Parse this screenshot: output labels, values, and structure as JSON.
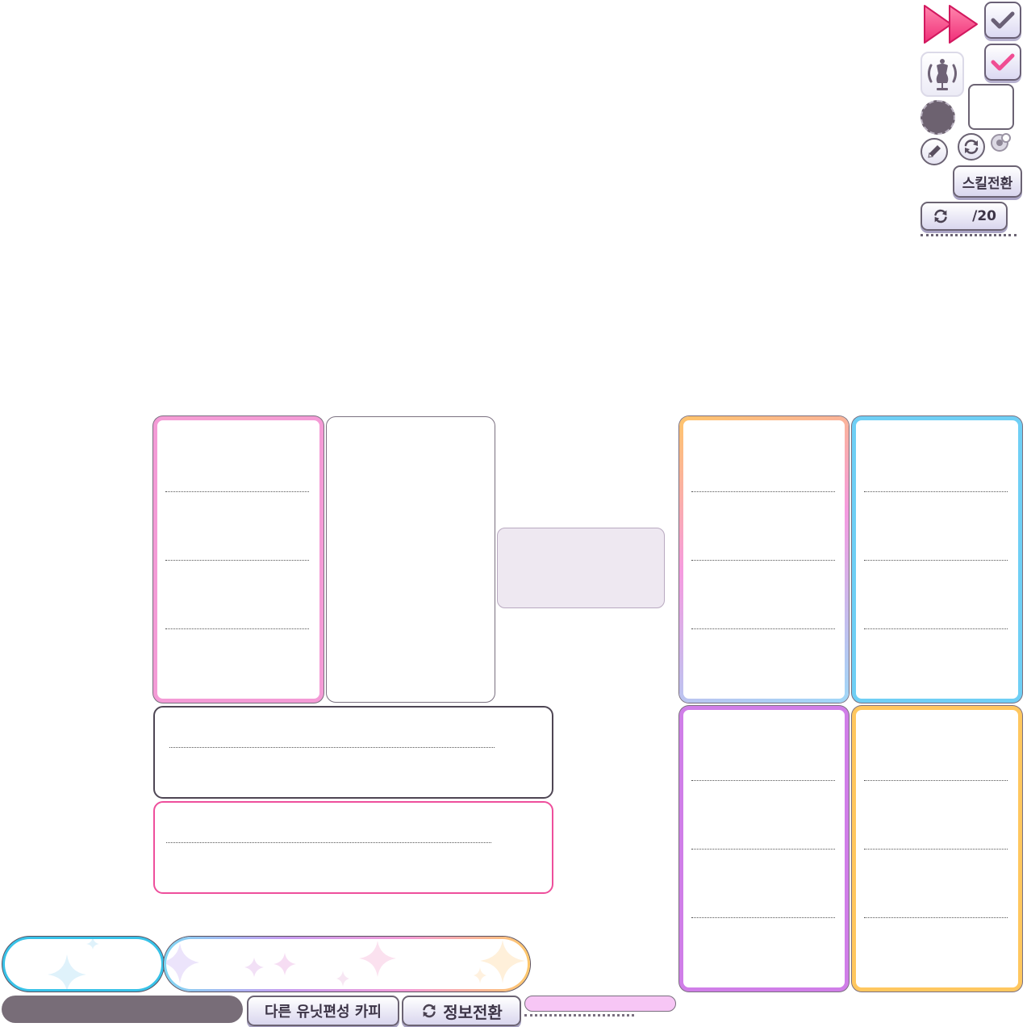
{
  "top_controls": {
    "skill_switch_label": "스킬전환",
    "refresh_count": "/20",
    "colors": {
      "fast_forward": "#ff4f8b",
      "check_gray": "#6a6076",
      "check_pink": "#f04d93"
    }
  },
  "bottom": {
    "copy_button_label": "다른 유닛편성 카피",
    "info_switch_label": "정보전환"
  }
}
